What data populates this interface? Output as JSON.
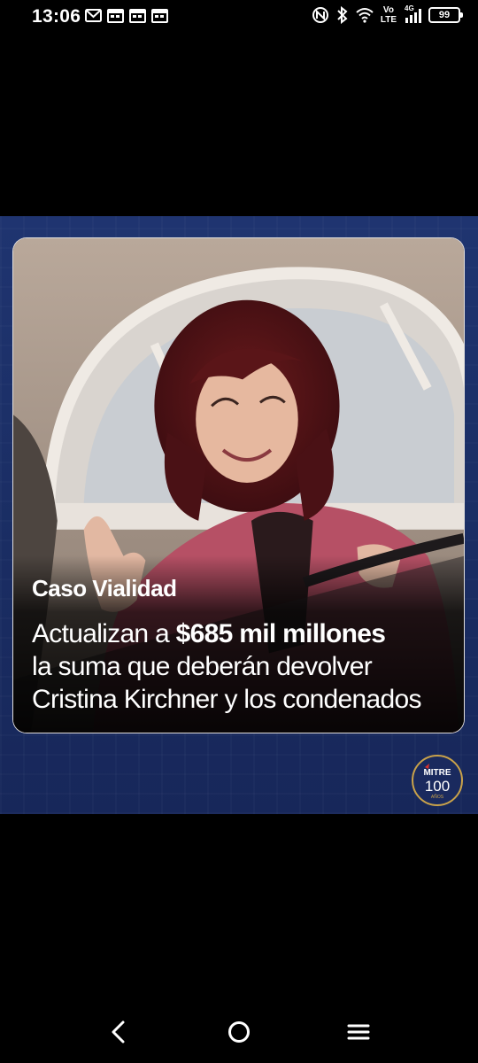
{
  "status_bar": {
    "time": "13:06",
    "notifications": [
      "gmail-icon",
      "calendar-icon",
      "calendar-icon",
      "calendar-icon"
    ],
    "network_label_top": "Vo",
    "network_label_bottom": "LTE",
    "signal_type": "4G",
    "battery": "99"
  },
  "post": {
    "kicker": "Caso Vialidad",
    "headline_prefix": "Actualizan a ",
    "headline_highlight": "$685 mil millones",
    "headline_line2": "la suma que deberán devolver",
    "headline_line3": "Cristina Kirchner y los condenados",
    "logo": {
      "brand": "MITRE",
      "number": "100",
      "sub": "AÑOS"
    },
    "colors": {
      "background": "#1f3470",
      "caption_text": "#ffffff",
      "logo_gold": "#c9a24a"
    }
  },
  "nav": {
    "back": "back-icon",
    "home": "home-icon",
    "menu": "menu-icon"
  }
}
